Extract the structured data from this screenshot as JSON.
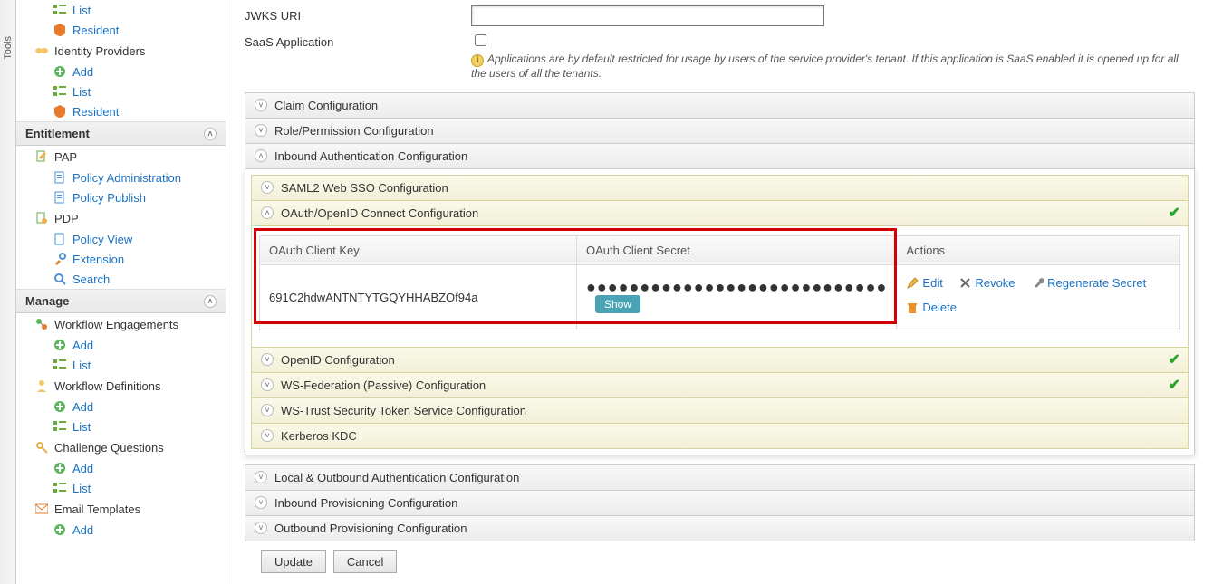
{
  "tools_strip": {
    "label": "Tools"
  },
  "sidebar": {
    "top_links": [
      {
        "label": "List",
        "name": "list"
      },
      {
        "label": "Resident",
        "name": "resident"
      }
    ],
    "idp_group": {
      "title": "Identity Providers",
      "links": [
        {
          "label": "Add",
          "name": "add"
        },
        {
          "label": "List",
          "name": "list"
        },
        {
          "label": "Resident",
          "name": "resident"
        }
      ]
    },
    "entitlement": {
      "title": "Entitlement",
      "pap": {
        "title": "PAP",
        "links": [
          {
            "label": "Policy Administration",
            "name": "policy-administration"
          },
          {
            "label": "Policy Publish",
            "name": "policy-publish"
          }
        ]
      },
      "pdp": {
        "title": "PDP",
        "links": [
          {
            "label": "Policy View",
            "name": "policy-view"
          },
          {
            "label": "Extension",
            "name": "extension"
          },
          {
            "label": "Search",
            "name": "search"
          }
        ]
      }
    },
    "manage": {
      "title": "Manage",
      "wfe": {
        "title": "Workflow Engagements",
        "links": [
          {
            "label": "Add",
            "name": "add"
          },
          {
            "label": "List",
            "name": "list"
          }
        ]
      },
      "wfd": {
        "title": "Workflow Definitions",
        "links": [
          {
            "label": "Add",
            "name": "add"
          },
          {
            "label": "List",
            "name": "list"
          }
        ]
      },
      "cq": {
        "title": "Challenge Questions",
        "links": [
          {
            "label": "Add",
            "name": "add"
          },
          {
            "label": "List",
            "name": "list"
          }
        ]
      },
      "et": {
        "title": "Email Templates",
        "links": [
          {
            "label": "Add",
            "name": "add"
          }
        ]
      }
    }
  },
  "form": {
    "jwks_label": "JWKS URI",
    "jwks_value": "",
    "saas_label": "SaaS Application",
    "saas_checked": false,
    "saas_helper": "Applications are by default restricted for usage by users of the service provider's tenant. If this application is SaaS enabled it is opened up for all the users of all the tenants."
  },
  "accordions": {
    "claim": "Claim Configuration",
    "role": "Role/Permission Configuration",
    "inbound_auth": "Inbound Authentication Configuration",
    "saml2": "SAML2 Web SSO Configuration",
    "oauth": "OAuth/OpenID Connect Configuration",
    "openid": "OpenID Configuration",
    "wsfed": "WS-Federation (Passive) Configuration",
    "wstrust": "WS-Trust Security Token Service Configuration",
    "kerberos": "Kerberos KDC",
    "local_outbound": "Local & Outbound Authentication Configuration",
    "inbound_prov": "Inbound Provisioning Configuration",
    "outbound_prov": "Outbound Provisioning Configuration"
  },
  "oauth_table": {
    "head_key": "OAuth Client Key",
    "head_secret": "OAuth Client Secret",
    "head_actions": "Actions",
    "client_key": "691C2hdwANTNTYTGQYHHABZOf94a",
    "client_secret_masked": "●●●●●●●●●●●●●●●●●●●●●●●●●●●●",
    "show_label": "Show",
    "actions": {
      "edit": "Edit",
      "revoke": "Revoke",
      "regen": "Regenerate Secret",
      "delete": "Delete"
    }
  },
  "buttons": {
    "update": "Update",
    "cancel": "Cancel"
  }
}
